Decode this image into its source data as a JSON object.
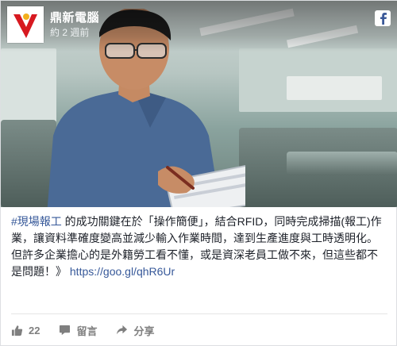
{
  "header": {
    "page_name": "鼎新電腦",
    "time": "約 2 週前"
  },
  "post": {
    "hashtag": "#現場報工",
    "text_1": " 的成功關鍵在於「操作簡便」，結合RFID，同時完成掃描(報工)作業，讓資料準確度變高並減少輸入作業時間，達到生產進度與工時透明化。",
    "text_2": "但許多企業擔心的是外籍勞工看不懂，或是資深老員工做不來，但這些都不是問題！》",
    "link": "https://goo.gl/qhR6Ur"
  },
  "actions": {
    "like_count": "22",
    "comment_label": "留言",
    "share_label": "分享"
  },
  "icons": {
    "facebook": "facebook-icon",
    "like": "thumbs-up-icon",
    "comment": "comment-icon",
    "share": "share-icon"
  },
  "colors": {
    "link": "#365899",
    "action_gray": "#7f7f7f",
    "logo_red": "#d71920"
  }
}
